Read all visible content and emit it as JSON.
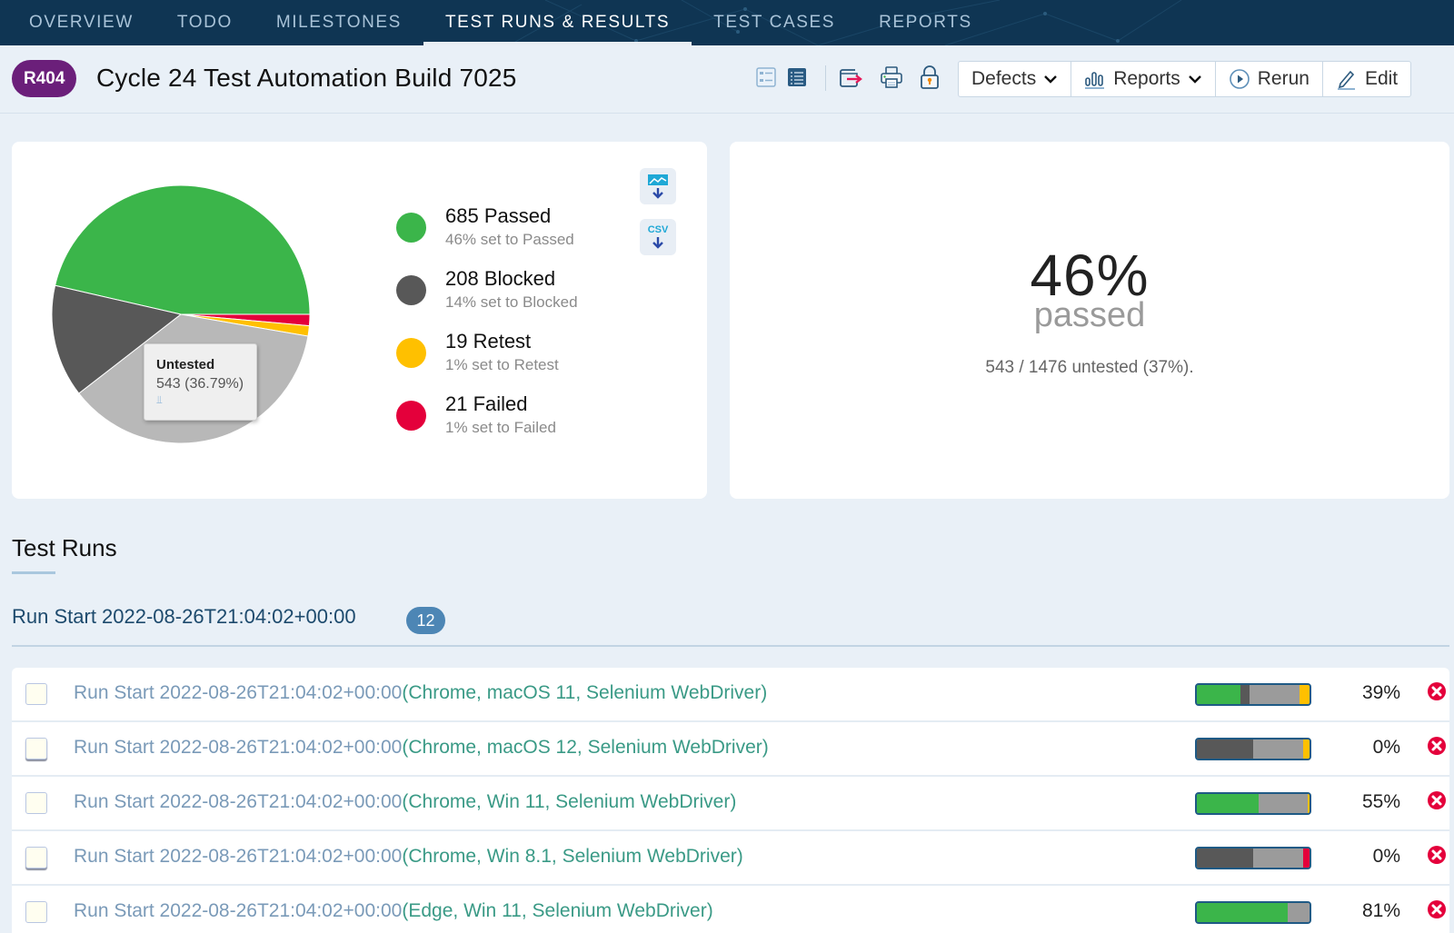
{
  "nav": {
    "tabs": [
      {
        "label": "OVERVIEW",
        "active": false
      },
      {
        "label": "TODO",
        "active": false
      },
      {
        "label": "MILESTONES",
        "active": false
      },
      {
        "label": "TEST RUNS & RESULTS",
        "active": true
      },
      {
        "label": "TEST CASES",
        "active": false
      },
      {
        "label": "REPORTS",
        "active": false
      }
    ]
  },
  "header": {
    "run_id": "R404",
    "title": "Cycle 24 Test Automation Build 7025",
    "toolbar_icons": [
      "compact-view-icon",
      "detailed-view-icon",
      "export-icon",
      "print-icon",
      "lock-icon"
    ],
    "buttons": {
      "defects": "Defects",
      "reports": "Reports",
      "rerun": "Rerun",
      "edit": "Edit"
    }
  },
  "chart_data": {
    "type": "pie",
    "title": "",
    "total": 1476,
    "slices": [
      {
        "label": "Passed",
        "value": 685,
        "color": "#3bb54a"
      },
      {
        "label": "Failed",
        "value": 21,
        "color": "#e4003b"
      },
      {
        "label": "Retest",
        "value": 19,
        "color": "#ffc000"
      },
      {
        "label": "Untested",
        "value": 543,
        "color": "#b8b8b8"
      },
      {
        "label": "Blocked",
        "value": 208,
        "color": "#585858"
      }
    ],
    "tooltip": {
      "title": "Untested",
      "value": "543 (36.79%)"
    },
    "legend": [
      {
        "count_label": "685 Passed",
        "sub": "46% set to Passed",
        "color": "#3bb54a"
      },
      {
        "count_label": "208 Blocked",
        "sub": "14% set to Blocked",
        "color": "#585858"
      },
      {
        "count_label": "19 Retest",
        "sub": "1% set to Retest",
        "color": "#ffc000"
      },
      {
        "count_label": "21 Failed",
        "sub": "1% set to Failed",
        "color": "#e4003b"
      }
    ],
    "legend_position": "right"
  },
  "exports": {
    "image_label": "",
    "csv_label": "CSV"
  },
  "summary": {
    "percent": "46%",
    "label": "passed",
    "untested_note": "543 / 1476 untested (37%)."
  },
  "test_runs": {
    "section_title": "Test Runs",
    "group": {
      "title": "Run Start 2022-08-26T21:04:02+00:00",
      "count": "12"
    },
    "rows": [
      {
        "name": "Run Start 2022-08-26T21:04:02+00:00",
        "config": "(Chrome, macOS 11, Selenium WebDriver)",
        "percent": "39%",
        "bar": {
          "passed": 0.39,
          "blocked": 0.08,
          "untested": 0.44,
          "retest": 0.09,
          "failed": 0
        }
      },
      {
        "name": "Run Start 2022-08-26T21:04:02+00:00",
        "config": "(Chrome, macOS 12, Selenium WebDriver)",
        "percent": "0%",
        "bar": {
          "passed": 0,
          "blocked": 0.5,
          "untested": 0.44,
          "retest": 0.06,
          "failed": 0
        }
      },
      {
        "name": "Run Start 2022-08-26T21:04:02+00:00",
        "config": "(Chrome, Win 11, Selenium WebDriver)",
        "percent": "55%",
        "bar": {
          "passed": 0.55,
          "blocked": 0,
          "untested": 0.43,
          "retest": 0.02,
          "failed": 0
        }
      },
      {
        "name": "Run Start 2022-08-26T21:04:02+00:00",
        "config": "(Chrome, Win 8.1, Selenium WebDriver)",
        "percent": "0%",
        "bar": {
          "passed": 0,
          "blocked": 0.5,
          "untested": 0.44,
          "retest": 0,
          "failed": 0.06
        }
      },
      {
        "name": "Run Start 2022-08-26T21:04:02+00:00",
        "config": "(Edge, Win 11, Selenium WebDriver)",
        "percent": "81%",
        "bar": {
          "passed": 0.81,
          "blocked": 0,
          "untested": 0.19,
          "retest": 0,
          "failed": 0
        }
      }
    ]
  },
  "colors": {
    "nav_bg": "#0f3553",
    "badge": "#6b1f7a",
    "passed": "#3bb54a",
    "blocked": "#585858",
    "untested": "#9b9b9b",
    "retest": "#ffc000",
    "failed": "#e4003b",
    "run_link": "#7a9ab8",
    "run_config": "#3a9a86"
  }
}
